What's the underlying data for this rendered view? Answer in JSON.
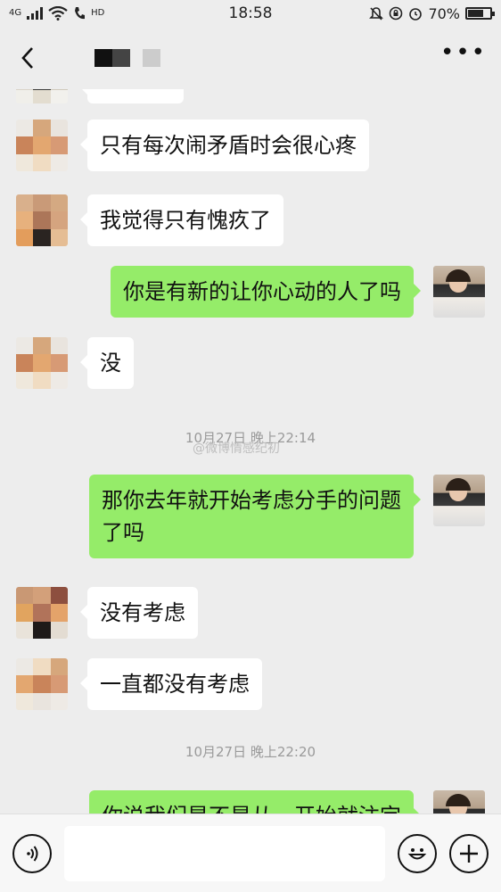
{
  "status_bar": {
    "signal": "4G",
    "hd": "HD",
    "time": "18:58",
    "battery": "70%",
    "battery_level": 0.7
  },
  "nav": {
    "title": ""
  },
  "messages": [
    {
      "side": "left",
      "text": "只有每次闹矛盾时会很心疼"
    },
    {
      "side": "left",
      "text": "我觉得只有愧疚了"
    },
    {
      "side": "right",
      "text": "你是有新的让你心动的人了吗"
    },
    {
      "side": "left",
      "text": "没"
    },
    {
      "type": "time",
      "text": "10月27日 晚上22:14"
    },
    {
      "side": "right",
      "text": "那你去年就开始考虑分手的问题\n了吗"
    },
    {
      "side": "left",
      "text": "没有考虑"
    },
    {
      "side": "left",
      "text": "一直都没有考虑"
    },
    {
      "type": "time",
      "text": "10月27日 晚上22:20"
    },
    {
      "side": "right",
      "text": "你说我们是不是从一开始就注定"
    }
  ],
  "watermark": "@微博情感纪初",
  "input": {
    "value": "",
    "placeholder": ""
  },
  "icons": [
    "back-icon",
    "more-icon",
    "voice-icon",
    "emoji-icon",
    "add-icon"
  ],
  "colors": {
    "background": "#ededed",
    "bubble_self": "#95ec69",
    "bubble_other": "#ffffff"
  }
}
